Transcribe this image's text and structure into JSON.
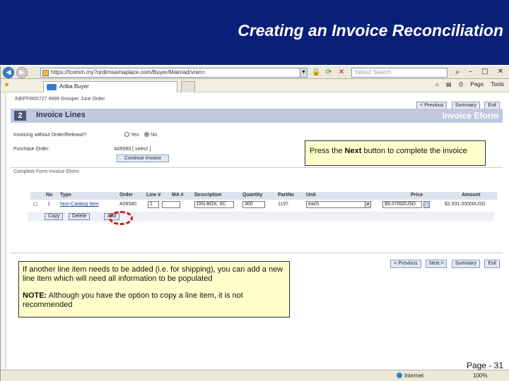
{
  "slide": {
    "title": "Creating an Invoice Reconciliation",
    "page_label": "Page - 31"
  },
  "browser": {
    "address": "https://fcomm.my?ordirnsamaplace.com/Buyer/Main/ad/vren=",
    "search_placeholder": "Yahoo! Search",
    "tab_title": "Ariba Buyer",
    "toolbar": {
      "page_label": "Page",
      "tools_label": "Tools"
    },
    "status": {
      "zone": "Internet",
      "zoom": "100%"
    },
    "icons": {
      "back": "back-arrow-icon",
      "forward": "forward-arrow-icon",
      "refresh": "refresh-icon",
      "stop": "stop-icon",
      "lock": "lock-icon"
    }
  },
  "form": {
    "context_line": "INEFF/805727 9999 Grouper June Order",
    "nav": {
      "prev": "< Previous",
      "summary": "Summary",
      "exit": "Exit"
    },
    "step_number": "2",
    "step_title": "Invoice Lines",
    "step_right": "Invoice Eform",
    "invoicing_label": "Invoicing without Order/Release?",
    "radio_yes": "Yes",
    "radio_no": "No",
    "po_label": "Purchase Order:",
    "po_value": "A09580 [ select ]",
    "continue_btn": "Continue Invoice",
    "sub_header": "Complete Form    Invoice Eform",
    "columns": [
      "No",
      "Type",
      "Order",
      "Line #",
      "MA #",
      "Description",
      "Quantity",
      "PartNo",
      "Unit",
      "Price",
      "Amount"
    ],
    "line": {
      "no": "1",
      "type": "Non-Catalog Item",
      "order": "A09580",
      "line_no": "1",
      "description": "DIN BOX, IIC",
      "quantity": "300",
      "partno": "1197",
      "unit": "each",
      "price": "$9.07000USD",
      "amount": "$2,931.00000USD"
    },
    "actions": {
      "copy": "Copy",
      "delete": "Delete",
      "add": "Add"
    },
    "nav_bottom": {
      "prev": "< Previous",
      "next": "Next >",
      "summary": "Summary",
      "exit": "Exit"
    }
  },
  "callouts": {
    "next_pre": "Press the ",
    "next_bold": "Next",
    "next_post": " button to complete the invoice",
    "add_text": "If another line item needs to be added (i.e. for shipping), you can add a new line item which will need all information to be populated",
    "note_bold": "NOTE:",
    "note_text": "  Although you have the option to copy a line item, it is not recommended"
  },
  "colors": {
    "title_band": "#0a1f78",
    "callout_bg": "#ffffcc",
    "highlight": "#cc1a1a",
    "step_bar": "#c4c8dc"
  }
}
